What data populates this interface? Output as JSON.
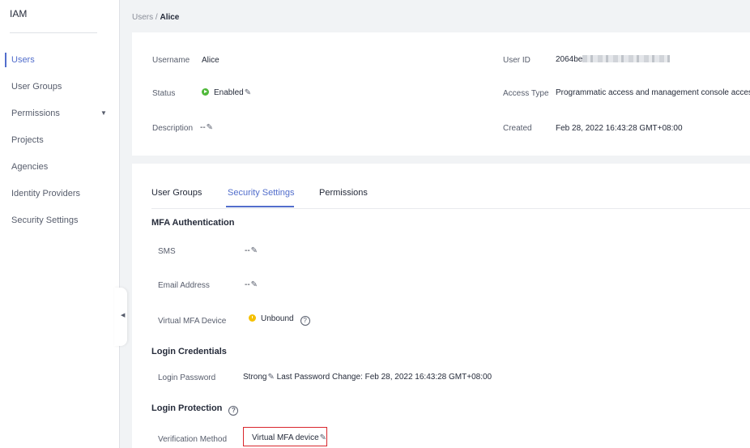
{
  "sidebar": {
    "title": "IAM",
    "items": [
      {
        "label": "Users"
      },
      {
        "label": "User Groups"
      },
      {
        "label": "Permissions"
      },
      {
        "label": "Projects"
      },
      {
        "label": "Agencies"
      },
      {
        "label": "Identity Providers"
      },
      {
        "label": "Security Settings"
      }
    ],
    "active_item": "Users"
  },
  "breadcrumb": {
    "parent": "Users",
    "separator": " / ",
    "current": "Alice"
  },
  "user_info": {
    "username_label": "Username",
    "username_value": "Alice",
    "status_label": "Status",
    "status_value": "Enabled",
    "description_label": "Description",
    "description_value": "--",
    "user_id_label": "User ID",
    "user_id_value": "2064be",
    "access_type_label": "Access Type",
    "access_type_value": "Programmatic access and management console access",
    "created_label": "Created",
    "created_value": "Feb 28, 2022 16:43:28 GMT+08:00"
  },
  "tabs": [
    {
      "label": "User Groups"
    },
    {
      "label": "Security Settings"
    },
    {
      "label": "Permissions"
    }
  ],
  "active_tab": "Security Settings",
  "mfa": {
    "title": "MFA Authentication",
    "sms_label": "SMS",
    "sms_value": "--",
    "email_label": "Email Address",
    "email_value": "--",
    "virtual_mfa_label": "Virtual MFA Device",
    "virtual_mfa_value": "Unbound"
  },
  "login_credentials": {
    "title": "Login Credentials",
    "password_label": "Login Password",
    "password_value": "Strong",
    "password_change": "Last Password Change: Feb 28, 2022 16:43:28 GMT+08:00"
  },
  "login_protection": {
    "title": "Login Protection",
    "method_label": "Verification Method",
    "method_value": "Virtual MFA device"
  },
  "icons": {
    "edit": "pencil-icon",
    "help": "question-circle-icon",
    "status_ok": "play-circle-icon",
    "status_warn": "warning-dot-icon",
    "collapse": "chevron-left-icon"
  },
  "colors": {
    "accent": "#526ecc",
    "enabled": "#50b93a",
    "warning": "#f5c000",
    "highlight": "#d9262c"
  }
}
